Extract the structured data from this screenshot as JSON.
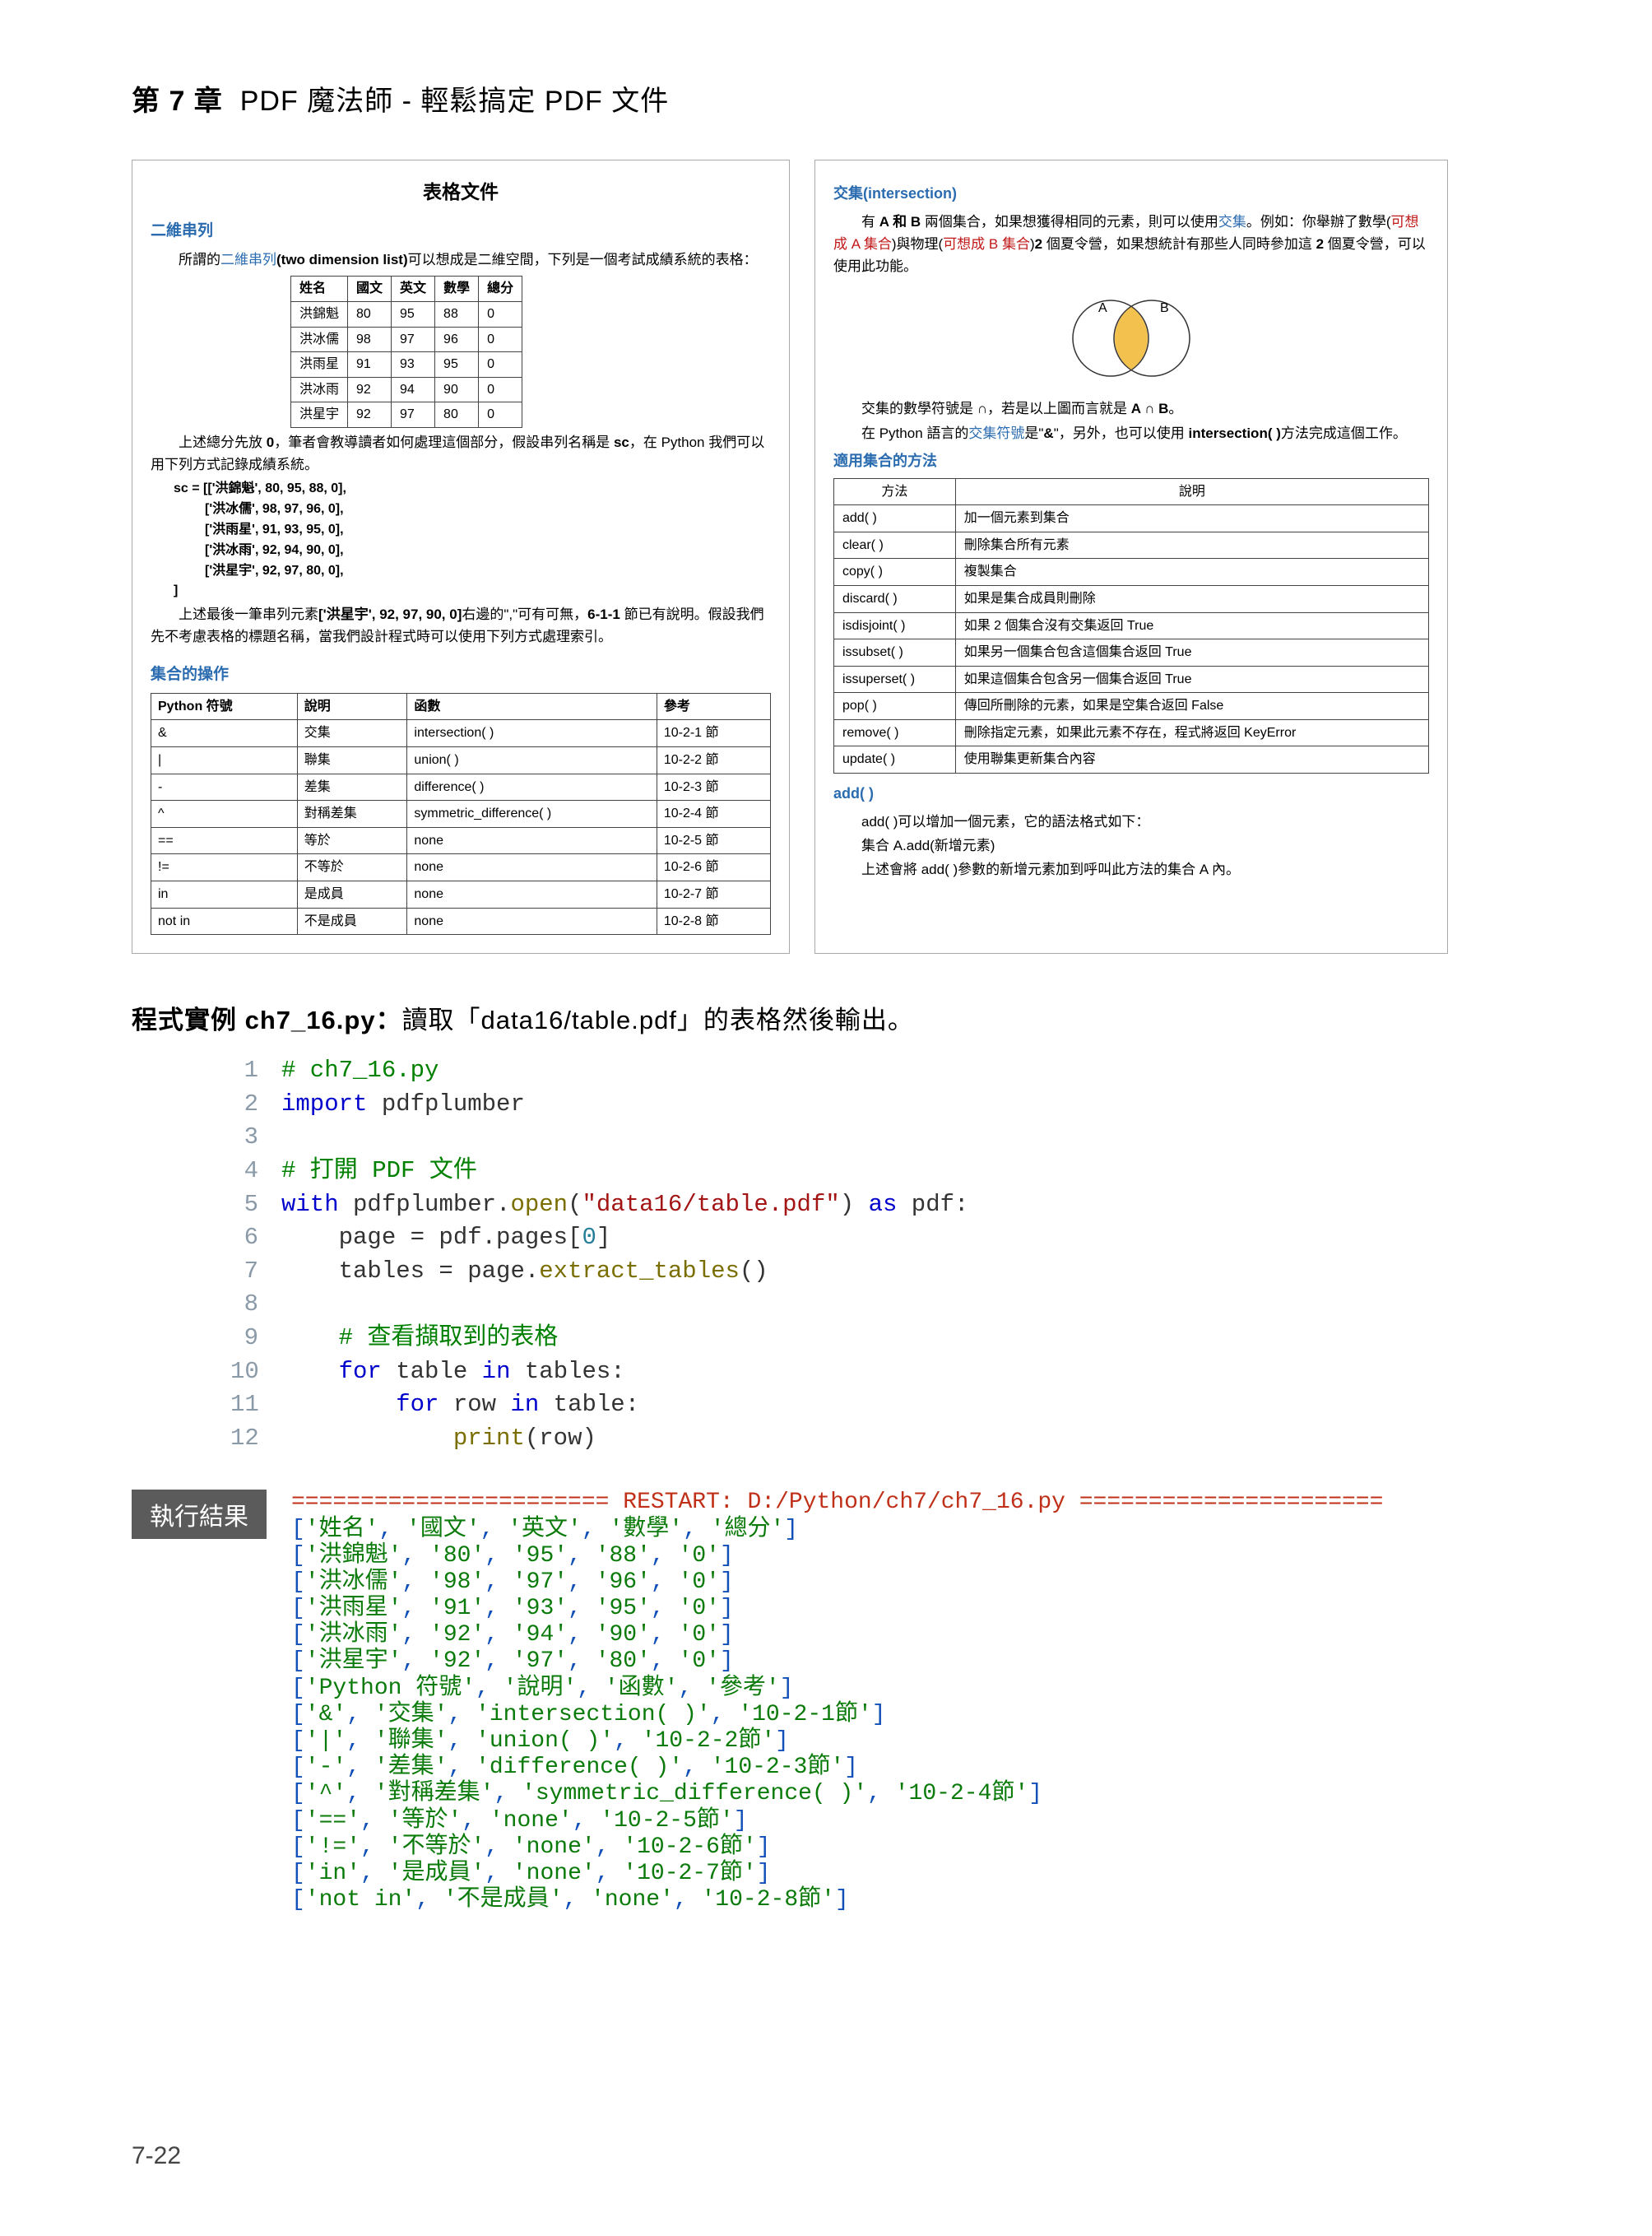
{
  "chapter": {
    "prefix": "第 7 章",
    "title": "PDF 魔法師 - 輕鬆搞定 PDF 文件"
  },
  "leftPanel": {
    "title": "表格文件",
    "h1": "二維串列",
    "p1a": "所謂的",
    "p1b": "二維串列",
    "p1c": "(two dimension list)",
    "p1d": "可以想成是二維空間，下列是一個考試成績系統的表格：",
    "thead": [
      "姓名",
      "國文",
      "英文",
      "數學",
      "總分"
    ],
    "trows": [
      [
        "洪錦魁",
        "80",
        "95",
        "88",
        "0"
      ],
      [
        "洪冰儒",
        "98",
        "97",
        "96",
        "0"
      ],
      [
        "洪雨星",
        "91",
        "93",
        "95",
        "0"
      ],
      [
        "洪冰雨",
        "92",
        "94",
        "90",
        "0"
      ],
      [
        "洪星宇",
        "92",
        "97",
        "80",
        "0"
      ]
    ],
    "p2a": "上述總分先放 ",
    "p2b": "0",
    "p2c": "，筆者會教導讀者如何處理這個部分，假設串列名稱是 ",
    "p2d": "sc",
    "p2e": "，在 Python 我們可以用下列方式記錄成績系統。",
    "sc0": "sc = [['洪錦魁', 80, 95, 88, 0],",
    "sc1": "['洪冰儒', 98, 97, 96, 0],",
    "sc2": "['洪雨星', 91, 93, 95, 0],",
    "sc3": "['洪冰雨', 92, 94, 90, 0],",
    "sc4": "['洪星宇', 92, 97, 80, 0],",
    "sc5": "]",
    "p3a": "上述最後一筆串列元素",
    "p3b": "['洪星宇', 92, 97, 90, 0]",
    "p3c": "右邊的\",\"可有可無，",
    "p3d": "6-1-1",
    "p3e": " 節已有說明。假設我們先不考慮表格的標題名稱，當我們設計程式時可以使用下列方式處理索引。",
    "h2": "集合的操作",
    "t2head": [
      "Python 符號",
      "說明",
      "函數",
      "參考"
    ],
    "t2rows": [
      [
        "&",
        "交集",
        "intersection( )",
        "10-2-1 節"
      ],
      [
        "|",
        "聯集",
        "union( )",
        "10-2-2 節"
      ],
      [
        "-",
        "差集",
        "difference( )",
        "10-2-3 節"
      ],
      [
        "^",
        "對稱差集",
        "symmetric_difference( )",
        "10-2-4 節"
      ],
      [
        "==",
        "等於",
        "none",
        "10-2-5 節"
      ],
      [
        "!=",
        "不等於",
        "none",
        "10-2-6 節"
      ],
      [
        "in",
        "是成員",
        "none",
        "10-2-7 節"
      ],
      [
        "not in",
        "不是成員",
        "none",
        "10-2-8 節"
      ]
    ]
  },
  "rightPanel": {
    "h1": "交集(intersection)",
    "p1a": "有 ",
    "p1b": "A 和 B",
    "p1c": " 兩個集合，如果想獲得相同的元素，則可以使用",
    "p1d": "交集",
    "p1e": "。例如：你舉辦了數學(",
    "p1f": "可想成 A 集合",
    "p1g": ")與物理(",
    "p1h": "可想成 B 集合",
    "p1i": ")",
    "p1j": "2",
    "p1k": " 個夏令營，如果想統計有那些人同時參加這 ",
    "p1l": "2",
    "p1m": " 個夏令營，可以使用此功能。",
    "p2a": "交集的數學符號是 ",
    "p2b": "∩",
    "p2c": "，若是以上圖而言就是 ",
    "p2d": "A ∩ B",
    "p2e": "。",
    "p3a": "在 Python 語言的",
    "p3b": "交集符號",
    "p3c": "是\"",
    "p3d": "&",
    "p3e": "\"，另外，也可以使用 ",
    "p3f": "intersection( )",
    "p3g": "方法完成這個工作。",
    "h2": "適用集合的方法",
    "t3head": [
      "方法",
      "說明"
    ],
    "t3rows": [
      [
        "add( )",
        "加一個元素到集合"
      ],
      [
        "clear( )",
        "刪除集合所有元素"
      ],
      [
        "copy( )",
        "複製集合"
      ],
      [
        "discard( )",
        "如果是集合成員則刪除"
      ],
      [
        "isdisjoint( )",
        "如果 2 個集合沒有交集返回 True"
      ],
      [
        "issubset( )",
        "如果另一個集合包含這個集合返回 True"
      ],
      [
        "issuperset( )",
        "如果這個集合包含另一個集合返回 True"
      ],
      [
        "pop( )",
        "傳回所刪除的元素，如果是空集合返回 False"
      ],
      [
        "remove( )",
        "刪除指定元素，如果此元素不存在，程式將返回 KeyError"
      ],
      [
        "update( )",
        "使用聯集更新集合內容"
      ]
    ],
    "addTitle": "add( )",
    "add1": "add( )可以增加一個元素，它的語法格式如下：",
    "add2": "集合 A.add(新增元素)",
    "add3": "上述會將 add( )參數的新增元素加到呼叫此方法的集合 A 內。"
  },
  "example": {
    "prefix": "程式實例 ",
    "name": "ch7_16.py",
    "colon": "：",
    "rest": "讀取「data16/table.pdf」的表格然後輸出。"
  },
  "code": [
    {
      "n": "1",
      "text": "# ch7_16.py",
      "cls": "c-green"
    },
    {
      "n": "2",
      "text": "import pdfplumber",
      "cls": ""
    },
    {
      "n": "3",
      "text": "",
      "cls": ""
    },
    {
      "n": "4",
      "text": "# 打開 PDF 文件",
      "cls": "c-green"
    },
    {
      "n": "5",
      "text": "with pdfplumber.open(\"data16/table.pdf\") as pdf:",
      "cls": ""
    },
    {
      "n": "6",
      "text": "    page = pdf.pages[0]",
      "cls": ""
    },
    {
      "n": "7",
      "text": "    tables = page.extract_tables()",
      "cls": ""
    },
    {
      "n": "8",
      "text": "",
      "cls": ""
    },
    {
      "n": "9",
      "text": "    # 查看擷取到的表格",
      "cls": "c-green"
    },
    {
      "n": "10",
      "text": "    for table in tables:",
      "cls": ""
    },
    {
      "n": "11",
      "text": "        for row in table:",
      "cls": ""
    },
    {
      "n": "12",
      "text": "            print(row)",
      "cls": ""
    }
  ],
  "resultBadge": "執行結果",
  "terminal": {
    "restart": "======================= RESTART: D:/Python/ch7/ch7_16.py ======================",
    "l1": "['姓名', '國文', '英文', '數學', '總分']",
    "l2": "['洪錦魁', '80', '95', '88', '0']",
    "l3": "['洪冰儒', '98', '97', '96', '0']",
    "l4": "['洪雨星', '91', '93', '95', '0']",
    "l5": "['洪冰雨', '92', '94', '90', '0']",
    "l6": "['洪星宇', '92', '97', '80', '0']",
    "l7": "['Python 符號', '說明', '函數', '參考']",
    "l8": "['&', '交集', 'intersection( )', '10-2-1節']",
    "l9": "['|', '聯集', 'union( )', '10-2-2節']",
    "l10": "['-', '差集', 'difference( )', '10-2-3節']",
    "l11": "['^', '對稱差集', 'symmetric_difference( )', '10-2-4節']",
    "l12": "['==', '等於', 'none', '10-2-5節']",
    "l13": "['!=', '不等於', 'none', '10-2-6節']",
    "l14": "['in', '是成員', 'none', '10-2-7節']",
    "l15": "['not in', '不是成員', 'none', '10-2-8節']"
  },
  "pageNum": "7-22"
}
